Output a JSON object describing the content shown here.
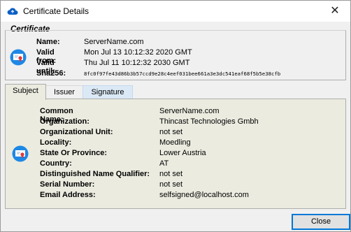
{
  "window": {
    "title": "Certificate Details",
    "icon": "cloud-icon",
    "close_glyph": "✕"
  },
  "certificate": {
    "section_label": "Certificate",
    "icon": "certificate-icon",
    "fields": [
      {
        "label": "Name:",
        "value": "ServerName.com"
      },
      {
        "label": "Valid from:",
        "value": "Mon Jul 13 10:12:32 2020 GMT"
      },
      {
        "label": "Valid until:",
        "value": "Thu Jul 11 10:12:32 2030 GMT"
      },
      {
        "label": "Sha256:",
        "value": "8fc0f97fe43d86b3b57ccd9e28c4eef031bee661a3e3dc541eaf68f5b5e38cfb"
      }
    ]
  },
  "tabs": [
    {
      "label": "Subject",
      "state": "active"
    },
    {
      "label": "Issuer",
      "state": "normal"
    },
    {
      "label": "Signature",
      "state": "hover"
    }
  ],
  "subject": {
    "icon": "certificate-icon",
    "fields": [
      {
        "label": "Common Name:",
        "value": "ServerName.com"
      },
      {
        "label": "Organization:",
        "value": "Thincast Technologies Gmbh"
      },
      {
        "label": "Organizational Unit:",
        "value": "not set"
      },
      {
        "label": "Locality:",
        "value": "Moedling"
      },
      {
        "label": "State Or Province:",
        "value": "Lower Austria"
      },
      {
        "label": "Country:",
        "value": "AT"
      },
      {
        "label": "Distinguished Name Qualifier:",
        "value": "not set"
      },
      {
        "label": "Serial Number:",
        "value": "not set"
      },
      {
        "label": "Email Address:",
        "value": "selfsigned@localhost.com"
      }
    ]
  },
  "buttons": {
    "close_label": "Close"
  },
  "colors": {
    "accent": "#0078d7",
    "panel_bg": "#ebebe0",
    "icon_blue": "#1e88e5",
    "icon_red": "#e53935"
  }
}
